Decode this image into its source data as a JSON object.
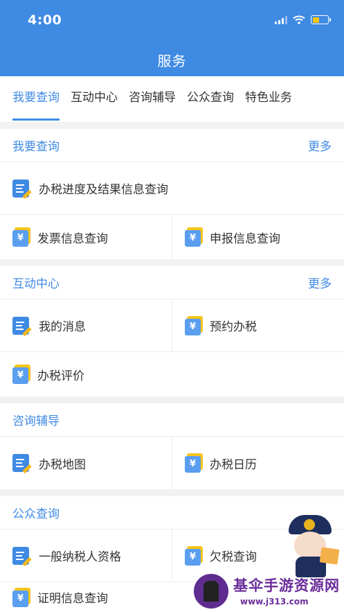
{
  "status_bar": {
    "time": "4:00"
  },
  "header": {
    "title": "服务"
  },
  "tabs": [
    {
      "label": "我要查询",
      "active": true
    },
    {
      "label": "互动中心",
      "active": false
    },
    {
      "label": "咨询辅导",
      "active": false
    },
    {
      "label": "公众查询",
      "active": false
    },
    {
      "label": "特色业务",
      "active": false
    }
  ],
  "sections": {
    "query": {
      "title": "我要查询",
      "more": "更多",
      "items": [
        {
          "label": "办税进度及结果信息查询",
          "icon": "document-pen-icon"
        },
        {
          "label": "发票信息查询",
          "icon": "yen-card-icon"
        },
        {
          "label": "申报信息查询",
          "icon": "yen-card-icon"
        }
      ]
    },
    "interaction": {
      "title": "互动中心",
      "more": "更多",
      "items": [
        {
          "label": "我的消息",
          "icon": "document-pen-icon"
        },
        {
          "label": "预约办税",
          "icon": "yen-card-icon"
        },
        {
          "label": "办税评价",
          "icon": "yen-card-icon"
        }
      ]
    },
    "consult": {
      "title": "咨询辅导",
      "items": [
        {
          "label": "办税地图",
          "icon": "document-pen-icon"
        },
        {
          "label": "办税日历",
          "icon": "yen-card-icon"
        }
      ]
    },
    "public": {
      "title": "公众查询",
      "items": [
        {
          "label": "一般纳税人资格",
          "icon": "document-pen-icon"
        },
        {
          "label": "欠税查询",
          "icon": "yen-card-icon"
        },
        {
          "label": "证明信息查询",
          "icon": "yen-card-icon"
        }
      ]
    }
  },
  "icon_glyph_yen": "¥",
  "watermark": {
    "text": "基伞手游资源网",
    "url": "www.j313.com"
  },
  "colors": {
    "accent": "#3f8ae3",
    "pen": "#f5b81a",
    "card_back": "#f5c518",
    "card_front": "#5a9ef0"
  }
}
